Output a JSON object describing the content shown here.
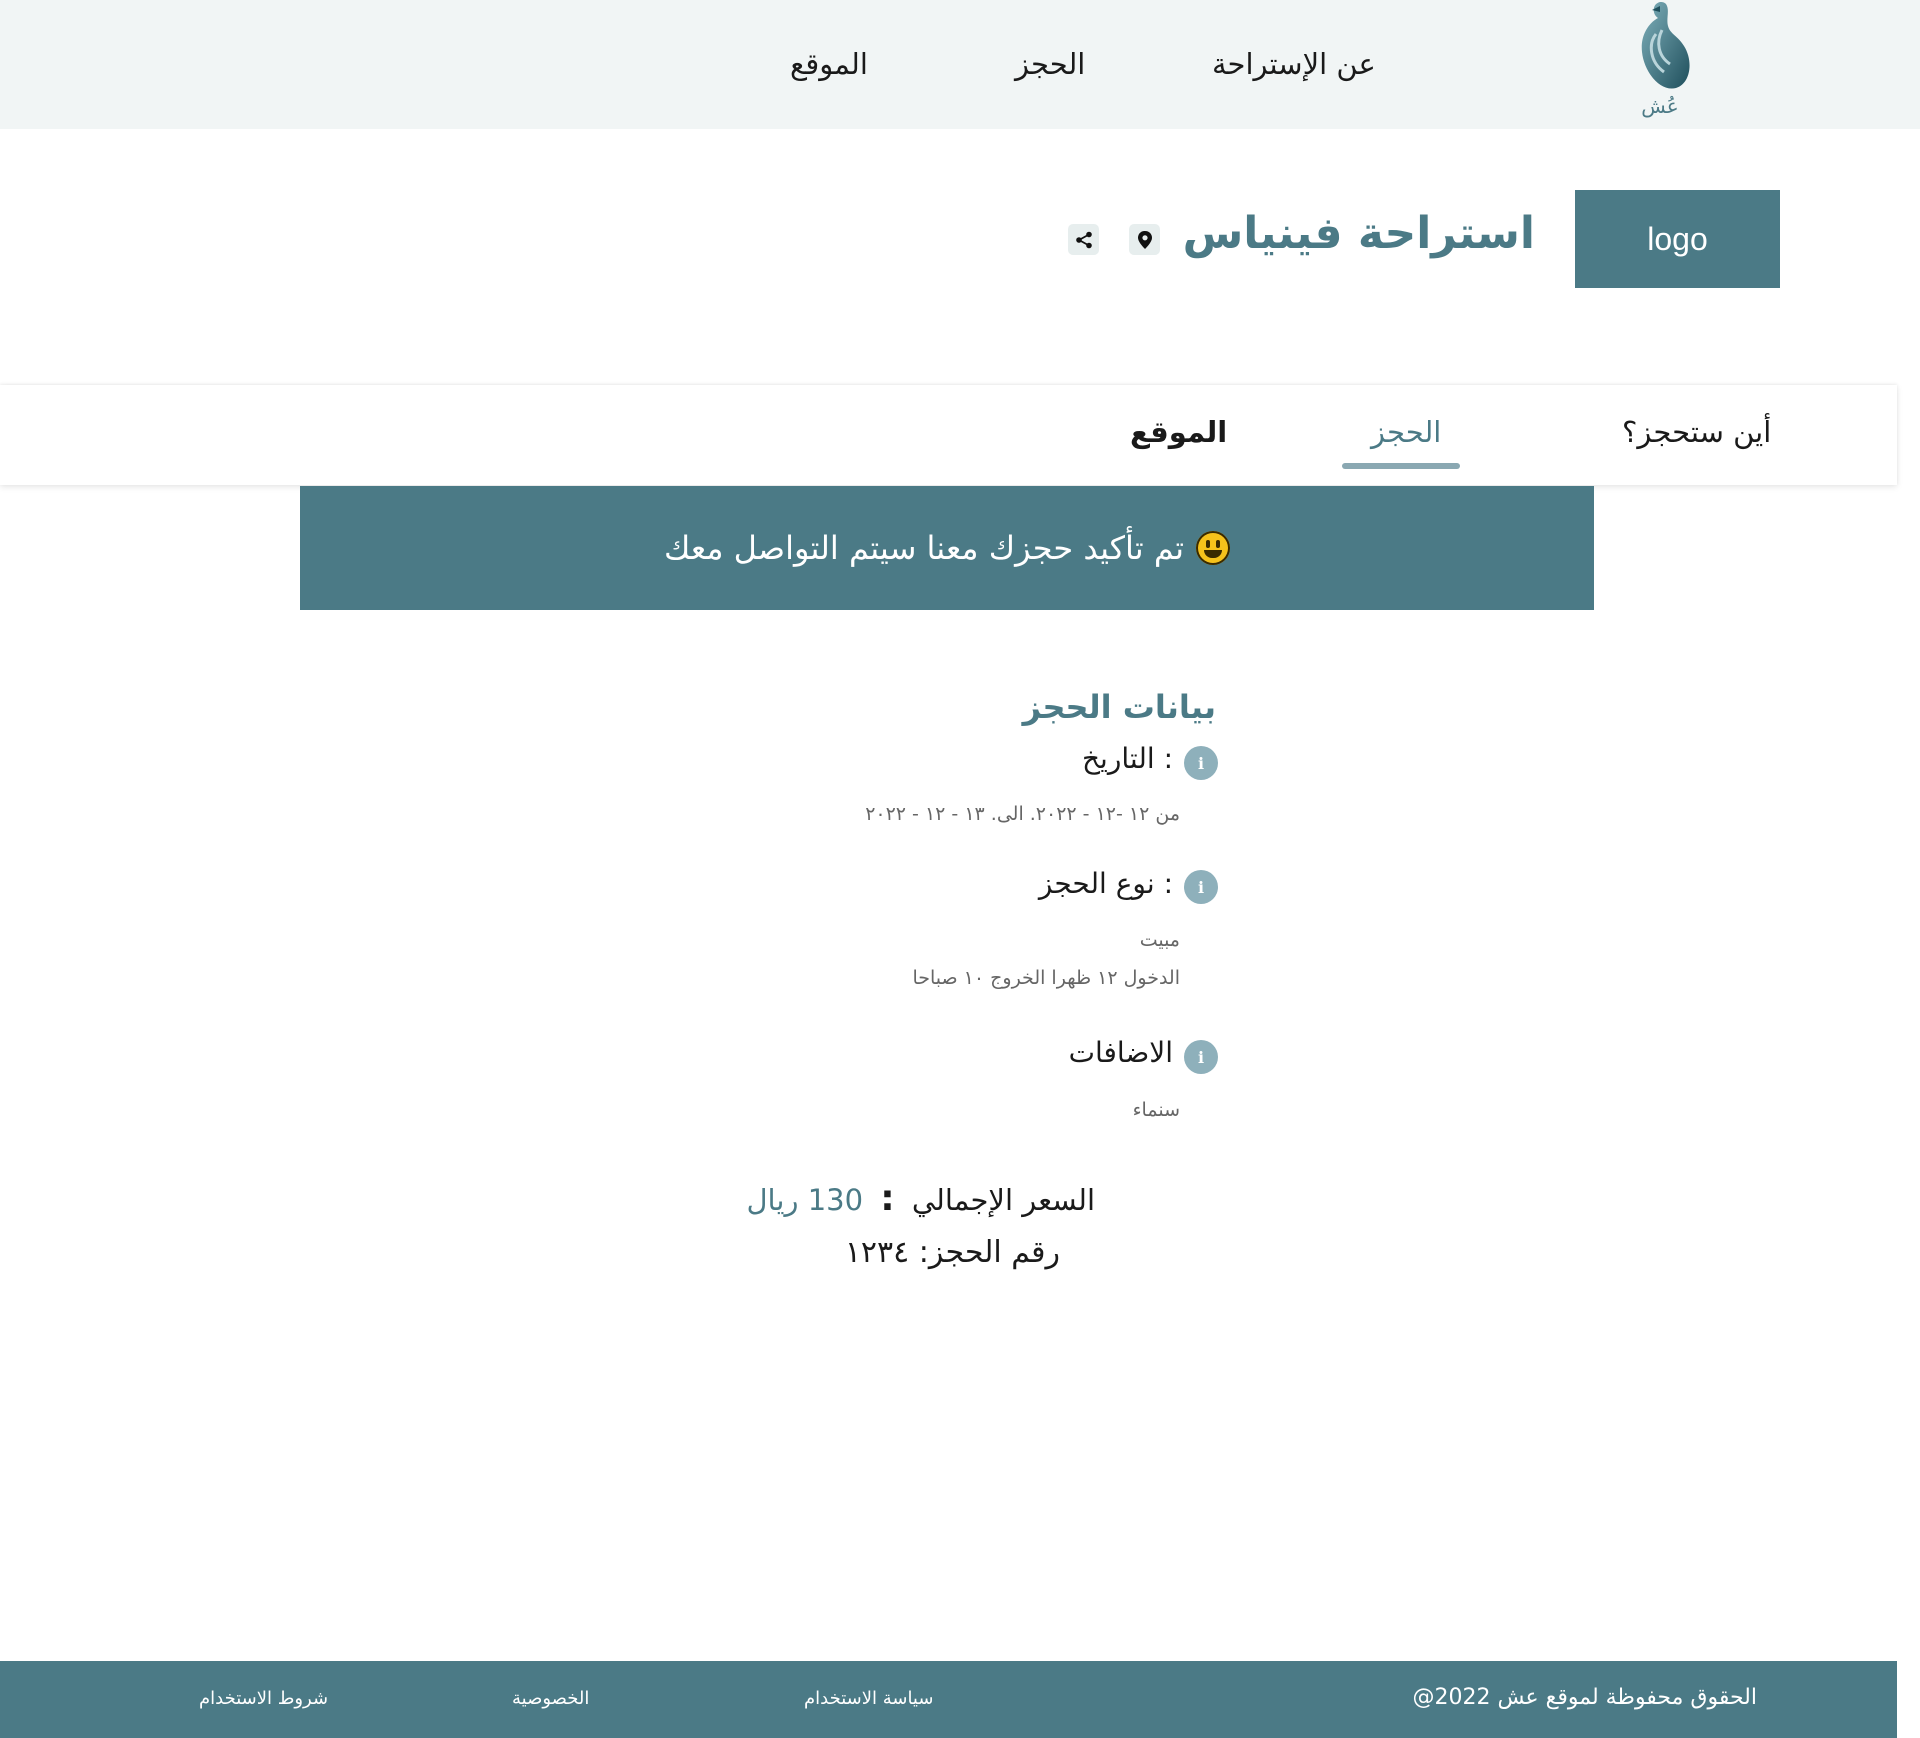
{
  "nav": {
    "brand_name": "عُش",
    "links": [
      "عن الإستراحة",
      "الحجز",
      "الموقع"
    ]
  },
  "header": {
    "logo_text": "logo",
    "title": "استراحة فينياس"
  },
  "tabs": [
    {
      "label": "أين ستحجز؟",
      "active": false
    },
    {
      "label": "الحجز",
      "active": true
    },
    {
      "label": "الموقع",
      "active": false
    }
  ],
  "banner": {
    "message": "تم تأكيد حجزك معنا سيتم التواصل معك",
    "icon": "smiley-icon"
  },
  "booking": {
    "title": "بيانات الحجز",
    "date_label": ": التاريخ",
    "date_value": "من ١٢ -١٢ - ٢٠٢٢.   الى.  ١٣ - ١٢ - ٢٠٢٢",
    "type_label": ": نوع الحجز",
    "type_value": "مبيت",
    "type_times": "الدخول ١٢ ظهرا    الخروج ١٠ صباحا",
    "extras_label": "الاضافات",
    "extras_value": "سنماء",
    "total_label": "السعر الإجمالي",
    "total_colon": ":",
    "total_value": "130 ريال",
    "booking_number": "رقم الحجز: ١٢٣٤"
  },
  "footer": {
    "copyright": "الحقوق محفوظة لموقع عش 2022@",
    "links": [
      "سياسة الاستخدام",
      "الخصوصية",
      "شروط الاستخدام"
    ]
  },
  "colors": {
    "primary": "#4b7a86",
    "topnav_bg": "#f1f5f5",
    "info_icon": "#8eb0bb",
    "tab_underline": "#8aa8b2"
  }
}
